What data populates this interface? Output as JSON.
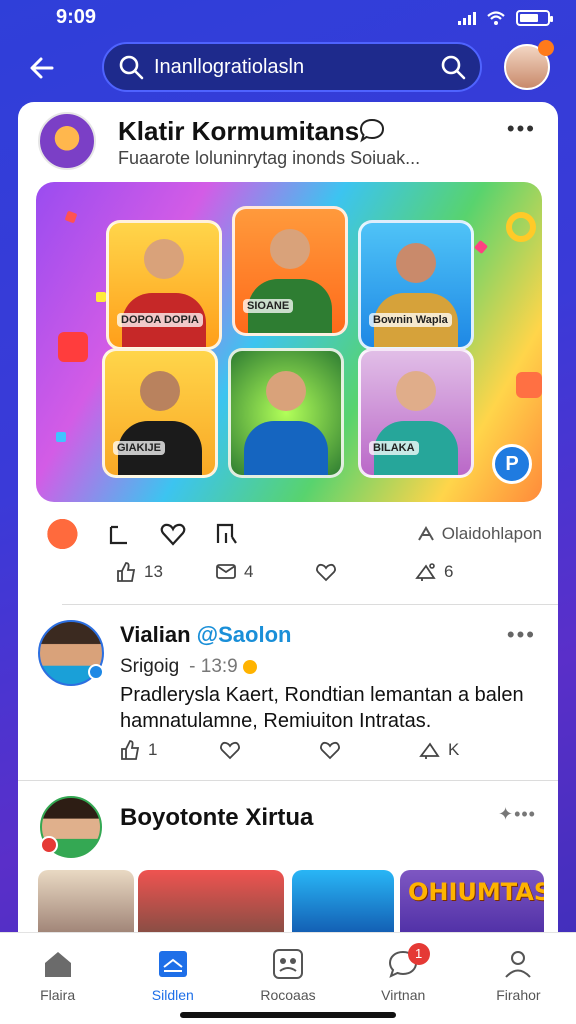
{
  "status_bar": {
    "time": "9:09"
  },
  "top_nav": {
    "search_value": "Inanllogratiolasln"
  },
  "post1": {
    "title": "Klatir Kormumitans",
    "subtitle": "Fuaarote loluninrytag inonds Soiuak...",
    "tile_captions": [
      "DOPOA DOPIA",
      "SIOANE",
      "Bownin Wapla",
      "GIAKIJE",
      "",
      "BILAKA"
    ],
    "share_label": "Olaidohlapon",
    "stats": {
      "likes": "13",
      "comments": "4",
      "reactions": "",
      "shares": "6"
    }
  },
  "post2": {
    "name": "Vialian",
    "handle": "@Saolon",
    "meta": "Srigoig",
    "time": "- 13:9",
    "text": "Pradlerysla Kaert, Rondtian lemantan a balen hamnatulamne, Remiuiton Intratas.",
    "stats": {
      "replies": "1",
      "reposts": "",
      "likes": "",
      "shares": "K"
    }
  },
  "post3": {
    "title": "Boyotonte Xirtua",
    "thumb_label": "OHIUMTAS"
  },
  "bottom_nav": {
    "items": [
      {
        "label": "Flaira",
        "icon": "home-icon"
      },
      {
        "label": "Sildlen",
        "icon": "video-icon"
      },
      {
        "label": "Rocoaas",
        "icon": "community-icon"
      },
      {
        "label": "Virtnan",
        "icon": "chat-icon",
        "badge": "1"
      },
      {
        "label": "Firahor",
        "icon": "profile-icon"
      }
    ]
  },
  "colors": {
    "accent": "#1e6fe8",
    "brand_bg": "#3a3ad8",
    "badge": "#e53935"
  }
}
